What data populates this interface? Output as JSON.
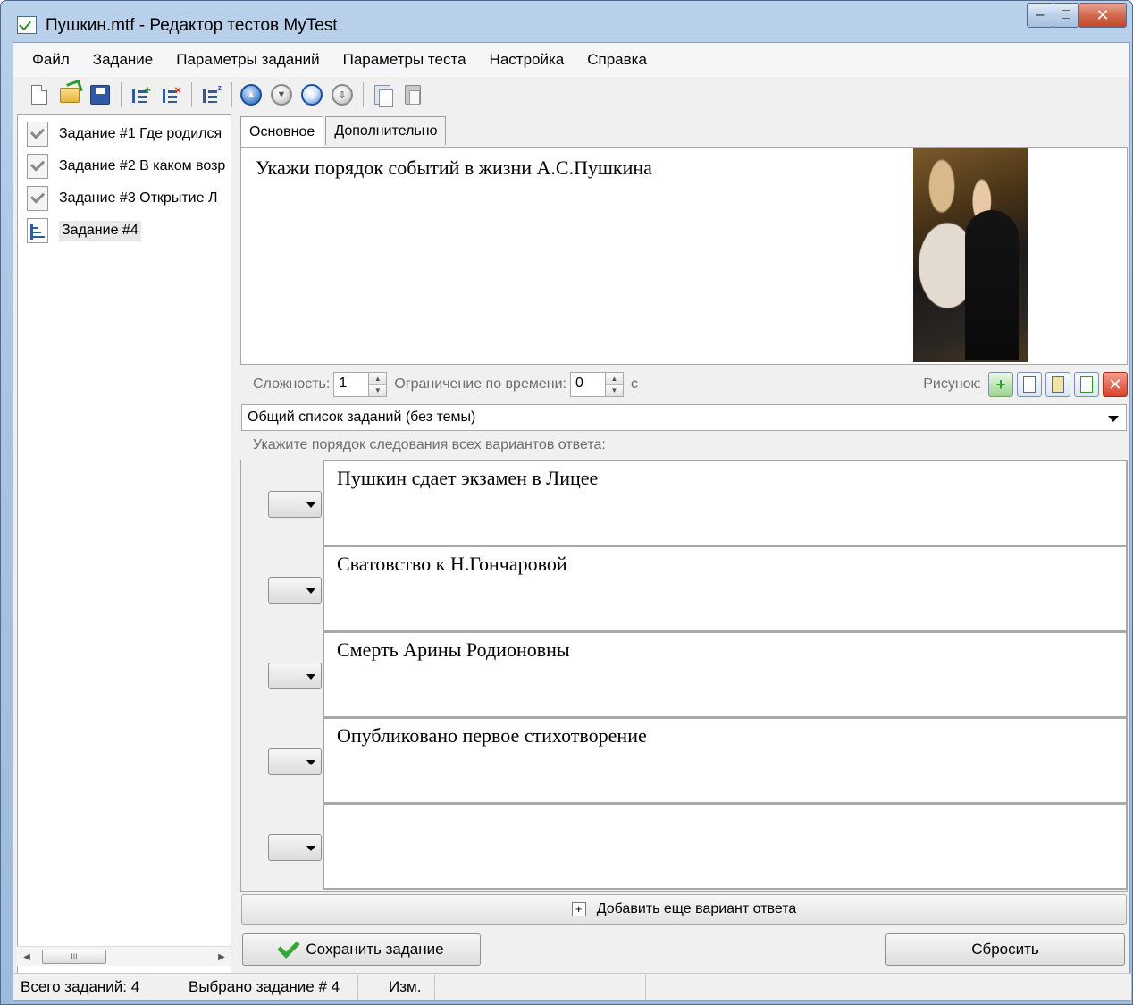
{
  "window": {
    "title": "Пушкин.mtf - Редактор тестов MyTest",
    "minimize": "–",
    "maximize": "□",
    "close": "✕"
  },
  "menu": [
    {
      "label": "Файл"
    },
    {
      "label": "Задание"
    },
    {
      "label": "Параметры заданий"
    },
    {
      "label": "Параметры теста"
    },
    {
      "label": "Настройка"
    },
    {
      "label": "Справка"
    }
  ],
  "tree": {
    "items": [
      {
        "label": "Задание #1 Где родился",
        "icon": "checked-task-icon"
      },
      {
        "label": "Задание #2 В каком возр",
        "icon": "checked-task-icon"
      },
      {
        "label": "Задание #3 Открытие Л",
        "icon": "checked-task-icon"
      },
      {
        "label": "Задание #4",
        "icon": "order-task-icon",
        "selected": true
      }
    ],
    "scroll_thumb": "III"
  },
  "tabs": [
    {
      "label": "Основное",
      "active": true
    },
    {
      "label": "Дополнительно",
      "active": false
    }
  ],
  "question": {
    "text": "Укажи порядок событий в жизни А.С.Пушкина"
  },
  "params": {
    "difficulty_label": "Сложность:",
    "difficulty_value": "1",
    "time_label": "Ограничение по времени:",
    "time_value": "0",
    "time_unit": "с",
    "picture_label": "Рисунок:"
  },
  "theme": {
    "selected": "Общий список заданий (без темы)"
  },
  "hint": "Укажите порядок следования всех вариантов ответа:",
  "answers": [
    {
      "text": "Пушкин сдает экзамен в Лицее"
    },
    {
      "text": "Сватовство к Н.Гончаровой"
    },
    {
      "text": "Смерть Арины Родионовны"
    },
    {
      "text": "Опубликовано первое стихотворение"
    },
    {
      "text": ""
    }
  ],
  "buttons": {
    "add_answer": "Добавить еще вариант ответа",
    "save": "Сохранить задание",
    "reset": "Сбросить"
  },
  "status": {
    "total": "Всего заданий: 4",
    "selected": "Выбрано задание # 4",
    "modified": "Изм."
  }
}
